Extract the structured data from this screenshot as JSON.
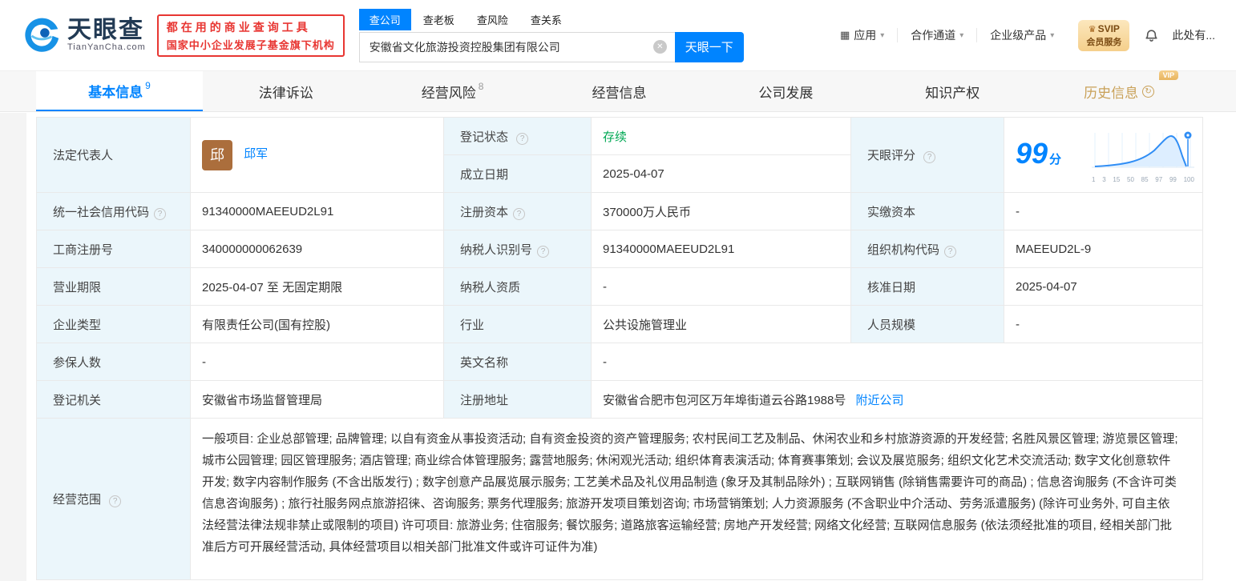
{
  "icons": {
    "help": "?",
    "caret": "▾",
    "clear": "✕",
    "crown": "♛",
    "apps": "▦",
    "history": "↻"
  },
  "header": {
    "brand": "天眼查",
    "brand_domain": "TianYanCha.com",
    "slogan_line1": "都在用的商业查询工具",
    "slogan_line2": "国家中小企业发展子基金旗下机构",
    "search_tabs": [
      {
        "label": "查公司"
      },
      {
        "label": "查老板"
      },
      {
        "label": "查风险"
      },
      {
        "label": "查关系"
      }
    ],
    "search_value": "安徽省文化旅游投资控股集团有限公司",
    "search_button": "天眼一下",
    "nav": [
      {
        "label": "应用"
      },
      {
        "label": "合作通道"
      },
      {
        "label": "企业级产品"
      }
    ],
    "vip_line1": "SVIP",
    "vip_line2": "会员服务",
    "notice": "此处有..."
  },
  "tabs": [
    {
      "label": "基本信息",
      "count": "9"
    },
    {
      "label": "法律诉讼"
    },
    {
      "label": "经营风险",
      "count": "8"
    },
    {
      "label": "经营信息"
    },
    {
      "label": "公司发展"
    },
    {
      "label": "知识产权"
    },
    {
      "label": "历史信息",
      "vip_tag": "VIP"
    }
  ],
  "info": {
    "legal_rep_label": "法定代表人",
    "avatar_char": "邱",
    "legal_rep_name": "邱军",
    "reg_status_label": "登记状态",
    "reg_status_value": "存续",
    "establish_label": "成立日期",
    "establish_value": "2025-04-07",
    "score_label": "天眼评分",
    "score_value": "99",
    "score_unit": "分",
    "score_axis": [
      "1",
      "3",
      "15",
      "50",
      "85",
      "97",
      "99",
      "100"
    ],
    "rows": [
      {
        "l1": "统一社会信用代码",
        "v1": "91340000MAEEUD2L91",
        "l2": "注册资本",
        "v2": "370000万人民币",
        "l3": "实缴资本",
        "v3": "-"
      },
      {
        "l1": "工商注册号",
        "v1": "340000000062639",
        "l2": "纳税人识别号",
        "v2": "91340000MAEEUD2L91",
        "l3": "组织机构代码",
        "v3": "MAEEUD2L-9"
      },
      {
        "l1": "营业期限",
        "v1": "2025-04-07 至 无固定期限",
        "l2": "纳税人资质",
        "v2": "-",
        "l3": "核准日期",
        "v3": "2025-04-07"
      },
      {
        "l1": "企业类型",
        "v1": "有限责任公司(国有控股)",
        "l2": "行业",
        "v2": "公共设施管理业",
        "l3": "人员规模",
        "v3": "-"
      },
      {
        "l1": "参保人数",
        "v1": "-",
        "l2": "英文名称",
        "v2": "-"
      },
      {
        "l1": "登记机关",
        "v1": "安徽省市场监督管理局",
        "l2": "注册地址",
        "v2": "安徽省合肥市包河区万年埠街道云谷路1988号",
        "link": "附近公司"
      }
    ],
    "scope_label": "经营范围",
    "scope_text": "一般项目: 企业总部管理; 品牌管理; 以自有资金从事投资活动; 自有资金投资的资产管理服务; 农村民间工艺及制品、休闲农业和乡村旅游资源的开发经营; 名胜风景区管理; 游览景区管理; 城市公园管理; 园区管理服务; 酒店管理; 商业综合体管理服务; 露营地服务; 休闲观光活动; 组织体育表演活动; 体育赛事策划; 会议及展览服务; 组织文化艺术交流活动; 数字文化创意软件开发; 数字内容制作服务 (不含出版发行) ; 数字创意产品展览展示服务; 工艺美术品及礼仪用品制造 (象牙及其制品除外) ; 互联网销售 (除销售需要许可的商品) ; 信息咨询服务 (不含许可类信息咨询服务) ; 旅行社服务网点旅游招徕、咨询服务; 票务代理服务; 旅游开发项目策划咨询; 市场营销策划; 人力资源服务 (不含职业中介活动、劳务派遣服务) (除许可业务外, 可自主依法经营法律法规非禁止或限制的项目) 许可项目: 旅游业务; 住宿服务; 餐饮服务; 道路旅客运输经营; 房地产开发经营; 网络文化经营; 互联网信息服务 (依法须经批准的项目, 经相关部门批准后方可开展经营活动, 具体经营项目以相关部门批准文件或许可证件为准)"
  }
}
